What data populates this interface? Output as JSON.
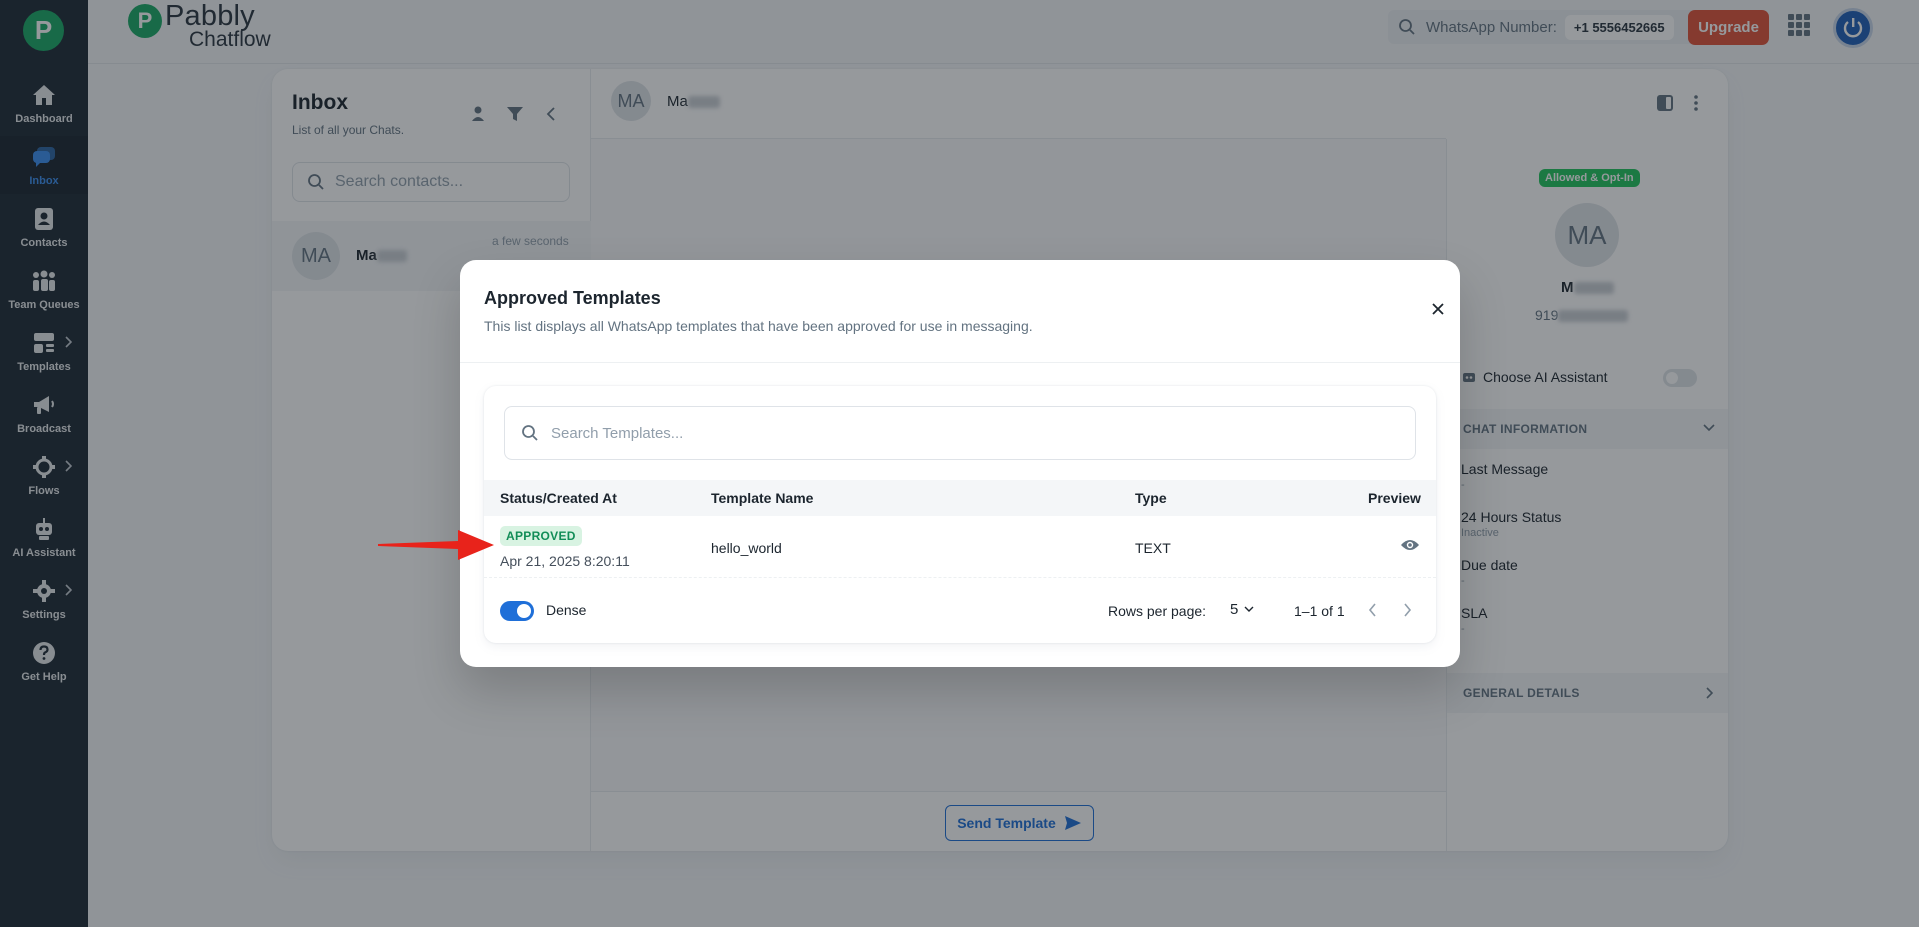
{
  "sidebar": {
    "logo": "P",
    "items": [
      {
        "label": "Dashboard",
        "icon": "home-icon"
      },
      {
        "label": "Inbox",
        "icon": "chat-icon",
        "active": true
      },
      {
        "label": "Contacts",
        "icon": "contacts-icon"
      },
      {
        "label": "Team Queues",
        "icon": "team-icon"
      },
      {
        "label": "Templates",
        "icon": "templates-icon",
        "expandable": true
      },
      {
        "label": "Broadcast",
        "icon": "megaphone-icon"
      },
      {
        "label": "Flows",
        "icon": "flows-icon",
        "expandable": true
      },
      {
        "label": "AI Assistant",
        "icon": "robot-icon"
      },
      {
        "label": "Settings",
        "icon": "gear-icon",
        "expandable": true
      },
      {
        "label": "Get Help",
        "icon": "help-icon"
      }
    ]
  },
  "header": {
    "brand_title": "Pabbly",
    "brand_sub": "Chatflow",
    "whatsapp_label": "WhatsApp Number:",
    "whatsapp_number": "+1 5556452665",
    "upgrade_label": "Upgrade"
  },
  "inbox": {
    "title": "Inbox",
    "subtitle": "List of all your Chats.",
    "search_placeholder": "Search contacts...",
    "contact": {
      "initials": "MA",
      "name": "Ma",
      "time": "a few seconds"
    }
  },
  "chat": {
    "initials": "MA",
    "name": "Ma",
    "send_template_label": "Send Template"
  },
  "info_panel": {
    "optin_badge": "Allowed & Opt-In",
    "initials": "MA",
    "name": "M",
    "phone": "919",
    "choose_ai_label": "Choose AI Assistant",
    "chat_information_label": "CHAT INFORMATION",
    "fields": [
      {
        "key": "Last Message",
        "value": "-"
      },
      {
        "key": "24 Hours Status",
        "value": "Inactive"
      },
      {
        "key": "Due date",
        "value": "-"
      },
      {
        "key": "SLA",
        "value": "-"
      }
    ],
    "general_details_label": "GENERAL DETAILS"
  },
  "modal": {
    "title": "Approved Templates",
    "subtitle": "This list displays all WhatsApp templates that have been approved for use in messaging.",
    "search_placeholder": "Search Templates...",
    "columns": [
      "Status/Created At",
      "Template Name",
      "Type",
      "Preview"
    ],
    "rows": [
      {
        "status": "APPROVED",
        "created_at": "Apr 21, 2025 8:20:11",
        "template_name": "hello_world",
        "type": "TEXT"
      }
    ],
    "dense_label": "Dense",
    "dense_on": true,
    "rows_per_page_label": "Rows per page:",
    "rows_per_page_value": "5",
    "range_label": "1–1 of 1"
  },
  "colors": {
    "sidebar_bg": "#1e2a36",
    "brand_green": "#1aaa66",
    "upgrade_red": "#e0533a",
    "primary_blue": "#1f6fd8",
    "approved_green": "#118d57",
    "annotation_arrow": "#e8231b"
  }
}
